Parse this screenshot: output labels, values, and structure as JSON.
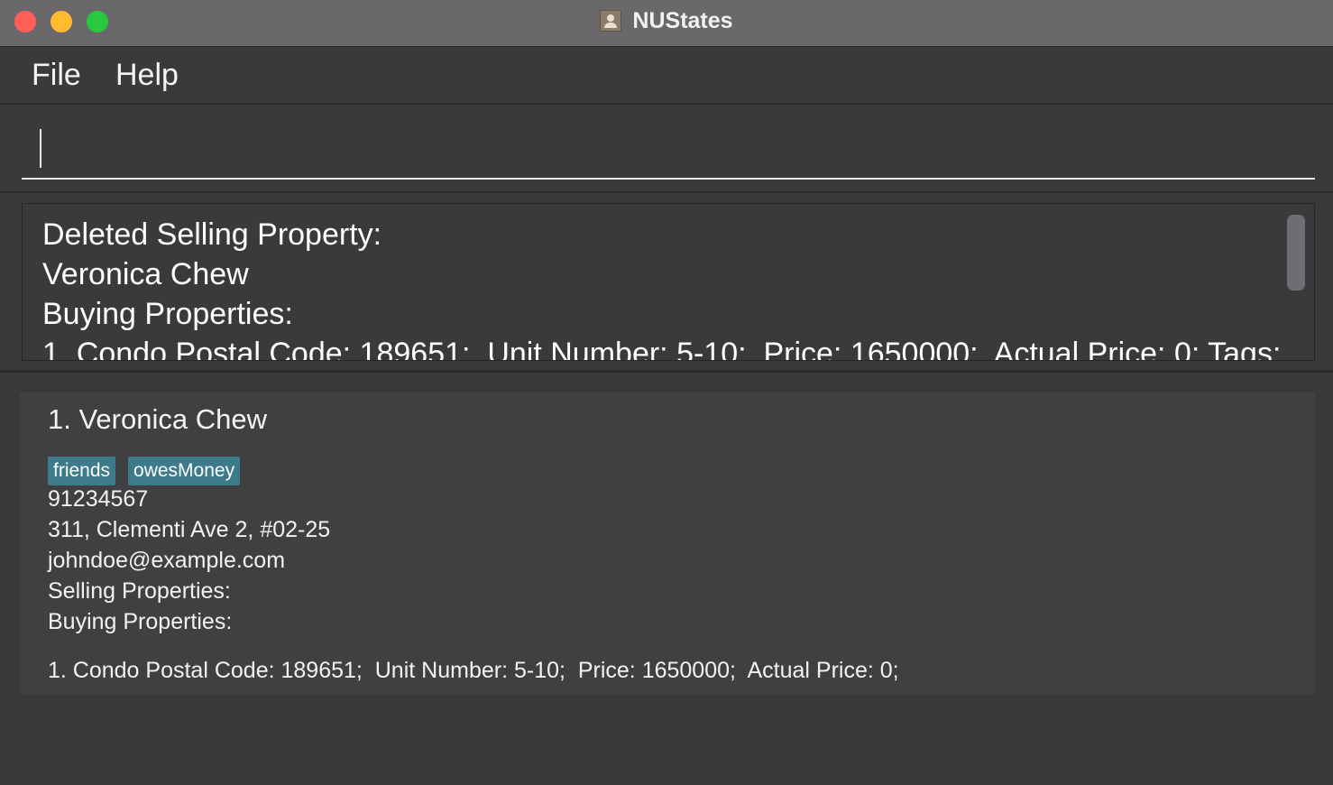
{
  "window": {
    "title": "NUStates",
    "controls": [
      "close",
      "minimize",
      "maximize"
    ],
    "app_icon": "person-icon"
  },
  "menu": {
    "items": [
      "File",
      "Help"
    ]
  },
  "command_box": {
    "value": ""
  },
  "result_display": {
    "lines": [
      "Deleted Selling Property:",
      "Veronica Chew",
      "Buying Properties:",
      "1. Condo Postal Code: 189651;  Unit Number: 5-10;  Price: 1650000;  Actual Price: 0; Tags:"
    ]
  },
  "person_list": [
    {
      "index_name": "1. Veronica Chew",
      "tags": [
        "friends",
        "owesMoney"
      ],
      "phone": "91234567",
      "address": "311, Clementi Ave 2, #02-25",
      "email": "johndoe@example.com",
      "selling_label": "Selling Properties:",
      "buying_label": "Buying Properties:",
      "buying_properties": [
        "1. Condo Postal Code: 189651;  Unit Number: 5-10;  Price: 1650000;  Actual Price: 0;"
      ]
    }
  ],
  "colors": {
    "background": "#3a3a3c",
    "tag": "#3d7a8a",
    "titlebar": "#6a686b"
  }
}
